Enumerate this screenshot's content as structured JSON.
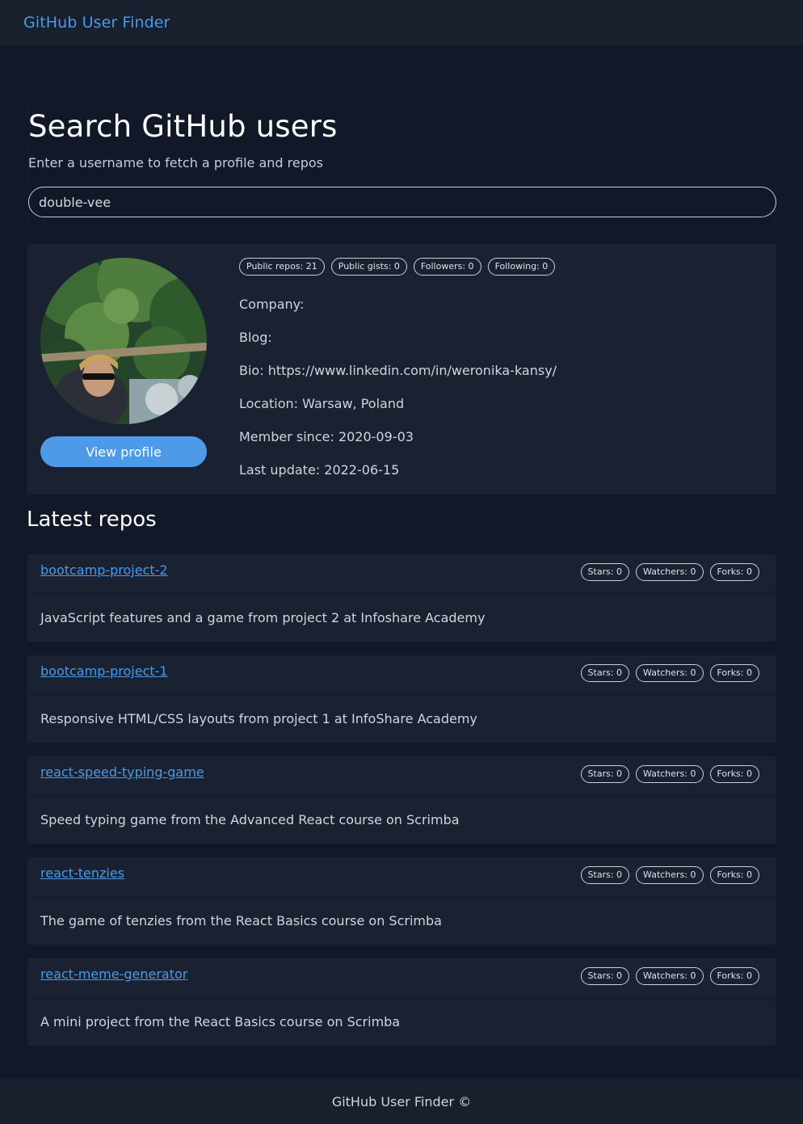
{
  "navbar": {
    "brand": "GitHub User Finder"
  },
  "search": {
    "title": "Search GitHub users",
    "subtitle": "Enter a username to fetch a profile and repos",
    "value": "double-vee"
  },
  "profile": {
    "view_button": "View profile",
    "stats": [
      "Public repos: 21",
      "Public gists: 0",
      "Followers: 0",
      "Following: 0"
    ],
    "details": [
      "Company:",
      "Blog:",
      "Bio: https://www.linkedin.com/in/weronika-kansy/",
      "Location: Warsaw, Poland",
      "Member since: 2020-09-03",
      "Last update: 2022-06-15"
    ]
  },
  "repos_section": {
    "title": "Latest repos"
  },
  "repos": [
    {
      "name": "bootcamp-project-2",
      "stars": "Stars: 0",
      "watchers": "Watchers: 0",
      "forks": "Forks: 0",
      "description": "JavaScript features and a game from project 2 at Infoshare Academy"
    },
    {
      "name": "bootcamp-project-1",
      "stars": "Stars: 0",
      "watchers": "Watchers: 0",
      "forks": "Forks: 0",
      "description": "Responsive HTML/CSS layouts from project 1 at InfoShare Academy"
    },
    {
      "name": "react-speed-typing-game",
      "stars": "Stars: 0",
      "watchers": "Watchers: 0",
      "forks": "Forks: 0",
      "description": "Speed typing game from the Advanced React course on Scrimba"
    },
    {
      "name": "react-tenzies",
      "stars": "Stars: 0",
      "watchers": "Watchers: 0",
      "forks": "Forks: 0",
      "description": "The game of tenzies from the React Basics course on Scrimba"
    },
    {
      "name": "react-meme-generator",
      "stars": "Stars: 0",
      "watchers": "Watchers: 0",
      "forks": "Forks: 0",
      "description": "A mini project from the React Basics course on Scrimba"
    }
  ],
  "footer": {
    "text": "GitHub User Finder ©"
  },
  "colors": {
    "background": "#111827",
    "card": "#1a2231",
    "accent": "#4a9ae8",
    "button": "#4d9be8"
  }
}
